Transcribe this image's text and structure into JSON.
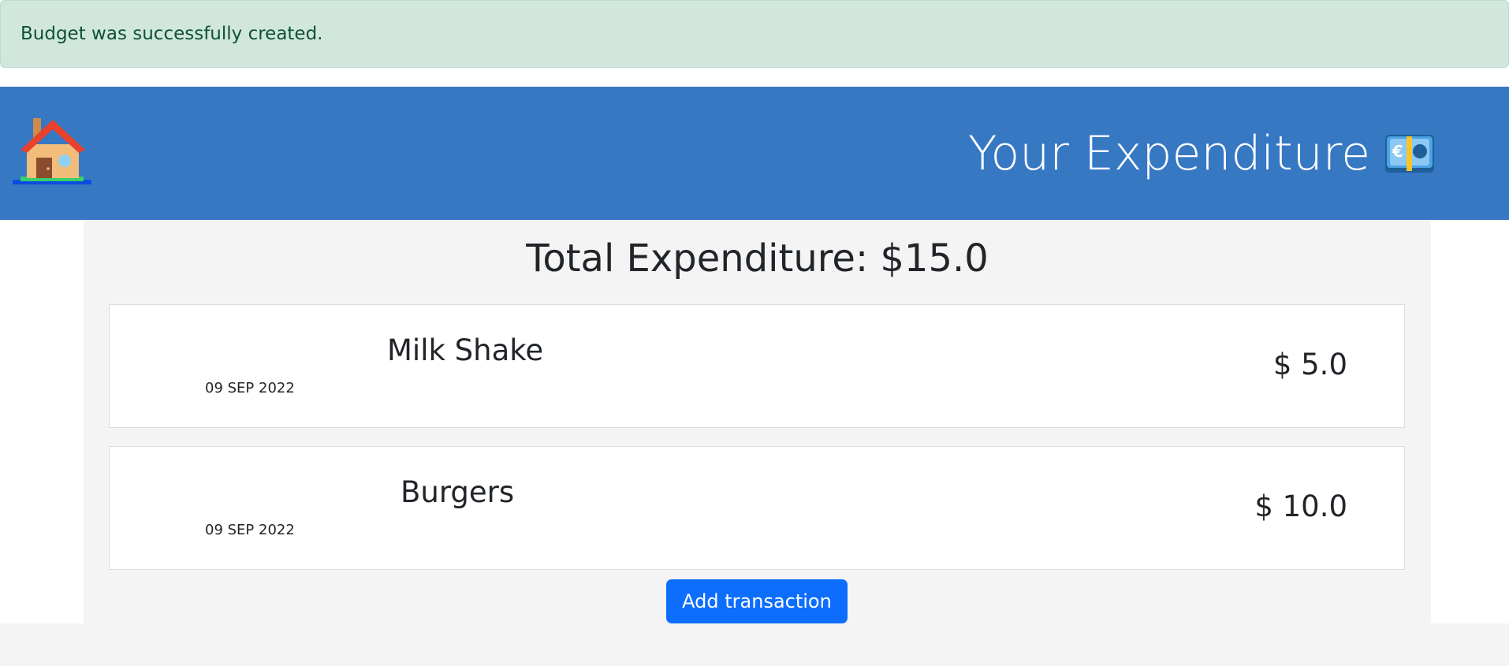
{
  "alert": {
    "message": "Budget was successfully created."
  },
  "navbar": {
    "home_icon": "house-icon",
    "title": "Your Expenditure",
    "title_icon": "money-euro-banknote-icon"
  },
  "main": {
    "total_label": "Total Expenditure: $15.0",
    "transactions": [
      {
        "name": "Milk Shake",
        "date": "09 SEP 2022",
        "amount": "$ 5.0"
      },
      {
        "name": "Burgers",
        "date": "09 SEP 2022",
        "amount": "$ 10.0"
      }
    ],
    "add_button_label": "Add transaction"
  },
  "colors": {
    "navbar": "#3778c3",
    "alert_bg": "#d1e7dd",
    "alert_text": "#0f5132",
    "button": "#0d6efd"
  }
}
